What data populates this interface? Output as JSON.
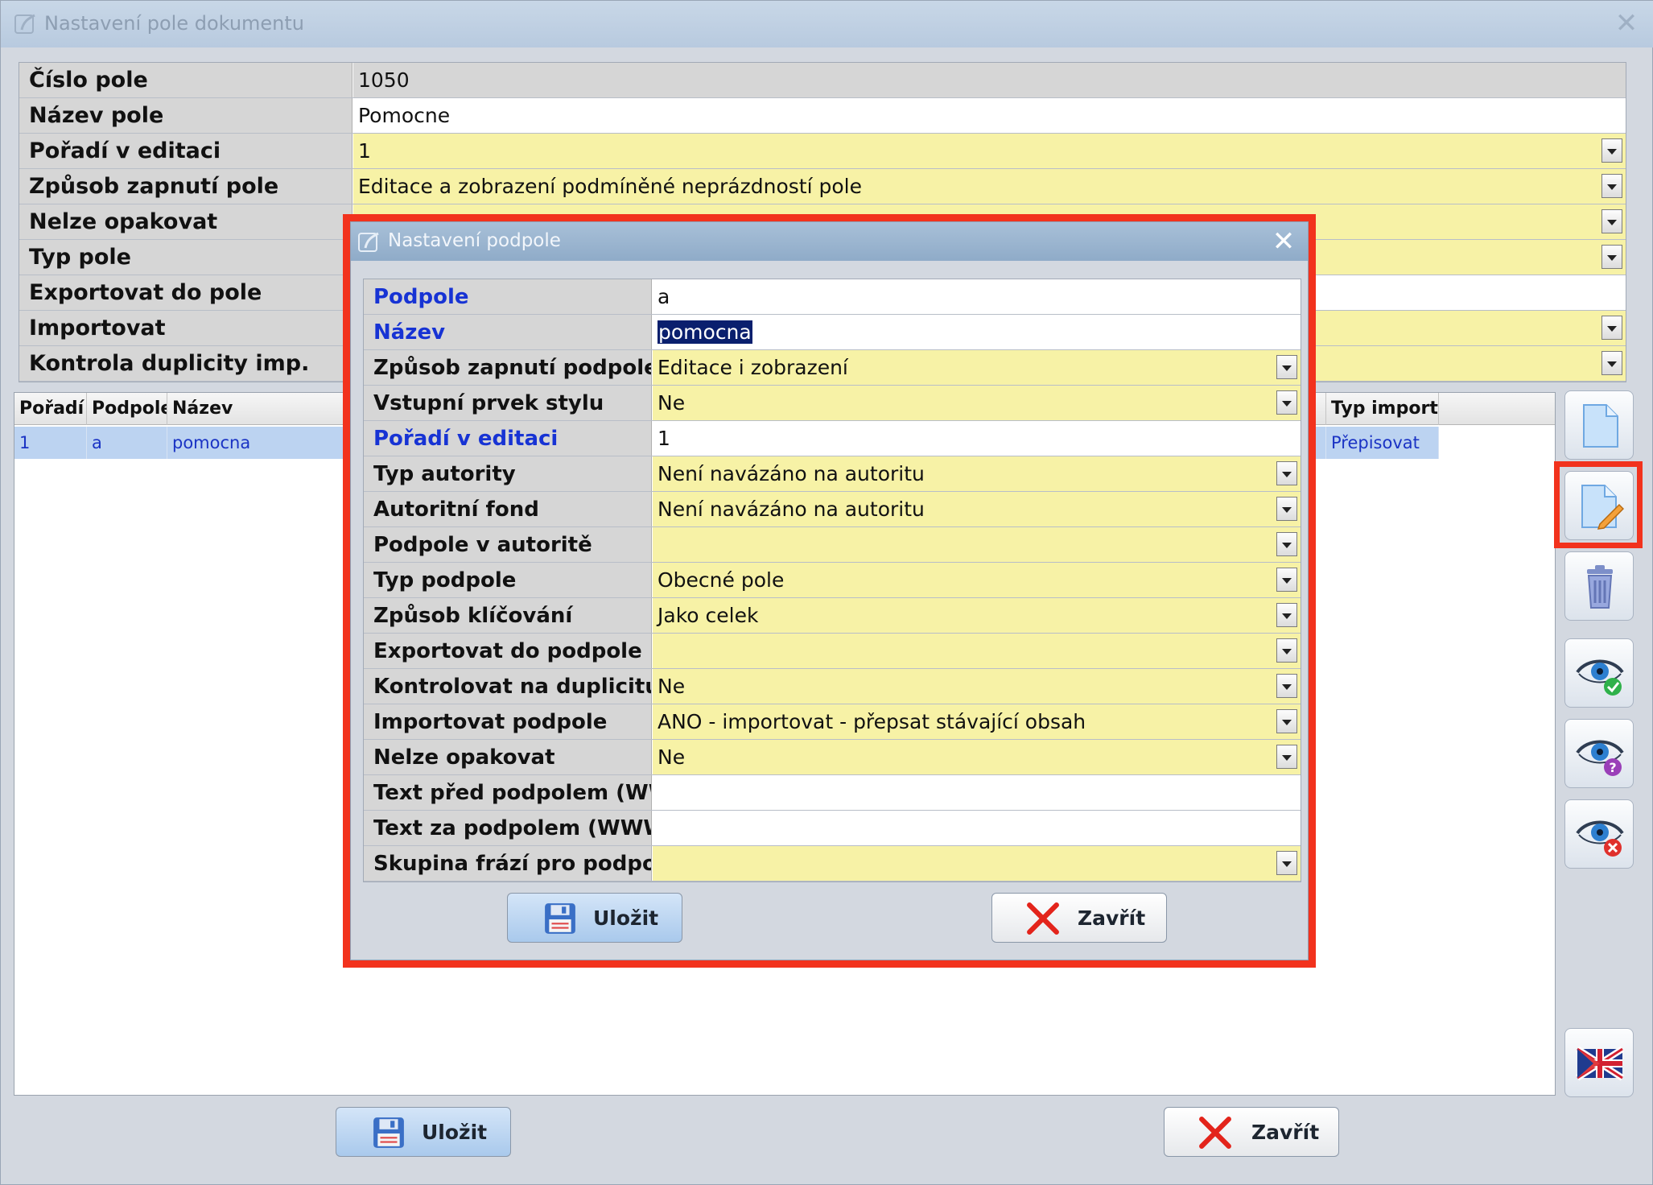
{
  "outer": {
    "title": "Nastavení pole dokumentu",
    "close": "✕",
    "fields": [
      {
        "label": "Číslo pole",
        "value": "1050",
        "bg": "gray",
        "dropdown": false
      },
      {
        "label": "Název pole",
        "value": "Pomocne",
        "bg": "white",
        "dropdown": false
      },
      {
        "label": "Pořadí v editaci",
        "value": "1",
        "bg": "yellow",
        "dropdown": true
      },
      {
        "label": "Způsob zapnutí pole",
        "value": "Editace a zobrazení podmíněné neprázdností pole",
        "bg": "yellow",
        "dropdown": true
      },
      {
        "label": "Nelze opakovat",
        "value": "",
        "bg": "yellow",
        "dropdown": true
      },
      {
        "label": "Typ pole",
        "value": "",
        "bg": "yellow",
        "dropdown": true
      },
      {
        "label": "Exportovat do pole",
        "value": "",
        "bg": "white",
        "dropdown": false
      },
      {
        "label": "Importovat",
        "value": "",
        "bg": "yellow",
        "dropdown": true
      },
      {
        "label": "Kontrola duplicity imp.",
        "value": "",
        "bg": "yellow",
        "dropdown": true
      }
    ],
    "list": {
      "headers": [
        "Pořadí",
        "Podpole",
        "Název",
        "Typ importu"
      ],
      "rows": [
        {
          "poradi": "1",
          "podpole": "a",
          "nazev": "pomocna",
          "typ_importu": "Přepisovat"
        }
      ]
    },
    "save_label": "Uložit",
    "close_label": "Zavřít"
  },
  "inner": {
    "title": "Nastavení podpole",
    "close": "✕",
    "fields": [
      {
        "label": "Podpole",
        "value": "a",
        "bg": "white",
        "dropdown": false,
        "required": true
      },
      {
        "label": "Název",
        "value": "pomocna",
        "bg": "white",
        "dropdown": false,
        "required": true,
        "selected": true
      },
      {
        "label": "Způsob zapnutí podpole",
        "value": "Editace i zobrazení",
        "bg": "yellow",
        "dropdown": true
      },
      {
        "label": "Vstupní prvek stylu",
        "value": "Ne",
        "bg": "yellow",
        "dropdown": true
      },
      {
        "label": "Pořadí v editaci",
        "value": "1",
        "bg": "white",
        "dropdown": false,
        "required": true
      },
      {
        "label": "Typ autority",
        "value": "Není navázáno na autoritu",
        "bg": "yellow",
        "dropdown": true
      },
      {
        "label": "Autoritní fond",
        "value": "Není navázáno na autoritu",
        "bg": "yellow",
        "dropdown": true
      },
      {
        "label": "Podpole v autoritě",
        "value": "",
        "bg": "yellow",
        "dropdown": true
      },
      {
        "label": "Typ podpole",
        "value": "Obecné pole",
        "bg": "yellow",
        "dropdown": true
      },
      {
        "label": "Způsob klíčování",
        "value": "Jako celek",
        "bg": "yellow",
        "dropdown": true
      },
      {
        "label": "Exportovat do podpole",
        "value": "",
        "bg": "yellow",
        "dropdown": true
      },
      {
        "label": "Kontrolovat na duplicitu",
        "value": "Ne",
        "bg": "yellow",
        "dropdown": true
      },
      {
        "label": "Importovat podpole",
        "value": "ANO - importovat - přepsat stávající obsah",
        "bg": "yellow",
        "dropdown": true
      },
      {
        "label": "Nelze opakovat",
        "value": "Ne",
        "bg": "yellow",
        "dropdown": true
      },
      {
        "label": "Text před podpolem (WWW)",
        "value": "",
        "bg": "white",
        "dropdown": false
      },
      {
        "label": "Text za podpolem (WWW)",
        "value": "",
        "bg": "white",
        "dropdown": false
      },
      {
        "label": "Skupina frází pro podpole",
        "value": "",
        "bg": "yellow",
        "dropdown": true
      }
    ],
    "save_label": "Uložit",
    "close_label": "Zavřít"
  },
  "toolbar": [
    "new-document-icon",
    "edit-document-icon",
    "trash-icon",
    "eye-check-icon",
    "eye-question-icon",
    "eye-cross-icon",
    "uk-flag-icon"
  ],
  "colors": {
    "highlight": "#f2321d",
    "required_label": "#1733d4",
    "yellow_field": "#f7f2a6"
  }
}
